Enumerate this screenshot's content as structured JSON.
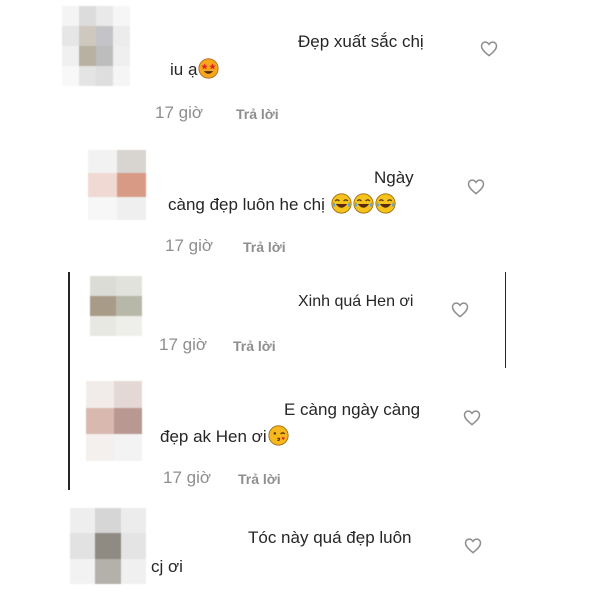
{
  "comments": [
    {
      "line1": "Đẹp xuất sắc chị",
      "line2": "iu ạ",
      "emoji": "star-struck-emoji",
      "time": "17 giờ",
      "reply": "Trả lời"
    },
    {
      "line1": "Ngày",
      "line2": "càng đẹp luôn he chị",
      "emoji": "tears-of-joy-emoji x3",
      "time": "17 giờ",
      "reply": "Trả lời"
    },
    {
      "line1": "Xinh quá Hen ơi",
      "time": "17 giờ",
      "reply": "Trả lời"
    },
    {
      "line1": "E càng ngày càng",
      "line2": "đẹp ak Hen ơi",
      "emoji": "kissing-wink-emoji",
      "time": "17 giờ",
      "reply": "Trả lời"
    },
    {
      "line1": "Tóc này quá đẹp luôn",
      "line2": "cj ơi"
    }
  ],
  "colors": {
    "text": "#262626",
    "muted": "#8e8e8e",
    "heart_stroke": "#8e8e8e"
  }
}
